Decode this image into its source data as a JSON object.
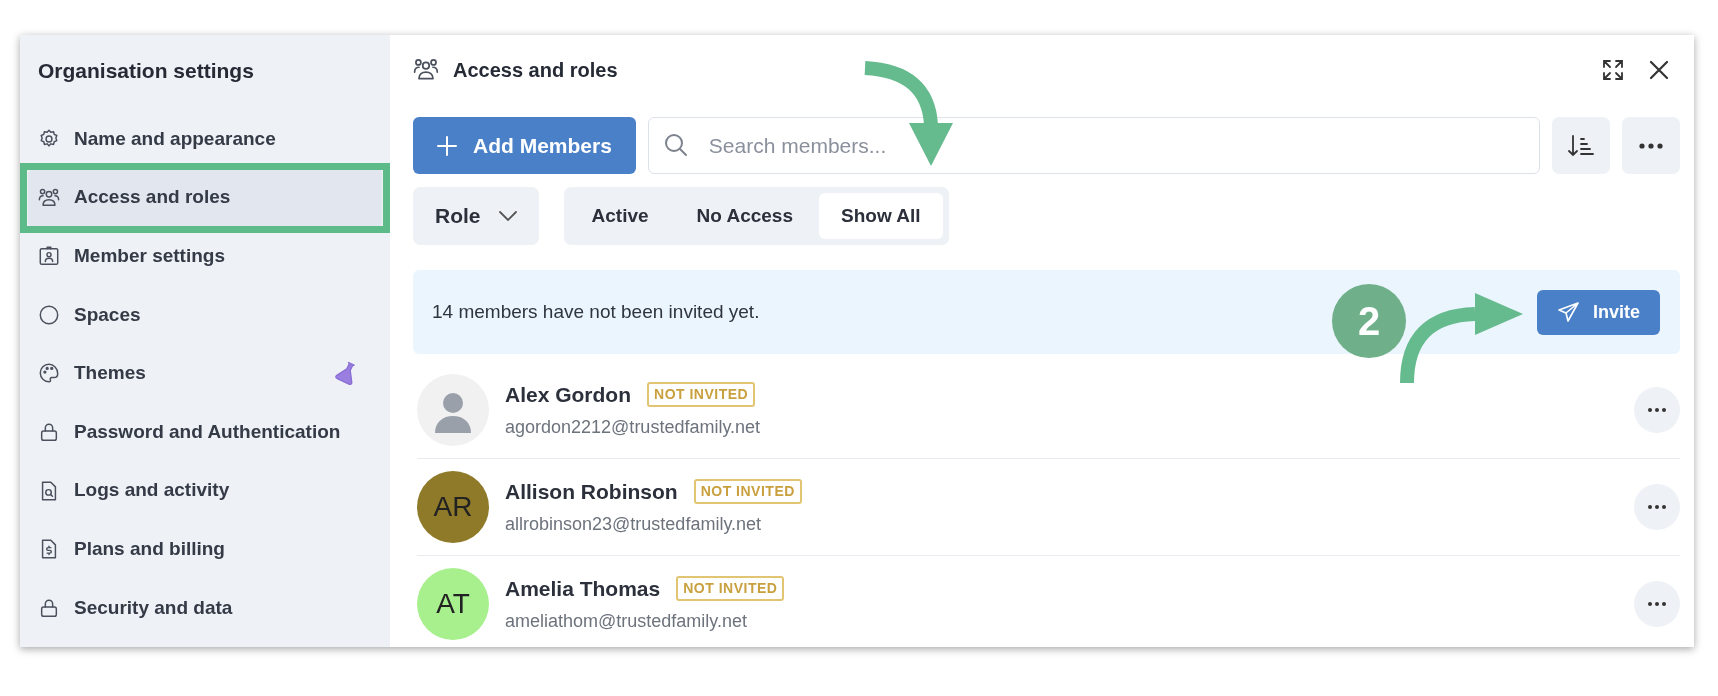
{
  "sidebar": {
    "title": "Organisation settings",
    "items": [
      {
        "label": "Name and appearance",
        "selected": false,
        "labs": false
      },
      {
        "label": "Access and roles",
        "selected": true,
        "labs": false
      },
      {
        "label": "Member settings",
        "selected": false,
        "labs": false
      },
      {
        "label": "Spaces",
        "selected": false,
        "labs": false
      },
      {
        "label": "Themes",
        "selected": false,
        "labs": true
      },
      {
        "label": "Password and Authentication",
        "selected": false,
        "labs": false
      },
      {
        "label": "Logs and activity",
        "selected": false,
        "labs": false
      },
      {
        "label": "Plans and billing",
        "selected": false,
        "labs": false
      },
      {
        "label": "Security and data",
        "selected": false,
        "labs": false
      }
    ]
  },
  "header": {
    "title": "Access and roles"
  },
  "toolbar": {
    "add_button": "Add Members",
    "search": {
      "placeholder": "Search members..."
    }
  },
  "filters": {
    "role": "Role",
    "segments": [
      {
        "label": "Active",
        "selected": false
      },
      {
        "label": "No Access",
        "selected": false
      },
      {
        "label": "Show All",
        "selected": true
      }
    ]
  },
  "banner": {
    "message": "14 members have not been invited yet.",
    "button": "Invite"
  },
  "members": [
    {
      "name": "Alex Gordon",
      "status": "NOT INVITED",
      "email": "agordon2212@trustedfamily.net",
      "avatar": {
        "kind": "photo"
      }
    },
    {
      "name": "Allison Robinson",
      "status": "NOT INVITED",
      "email": "allrobinson23@trustedfamily.net",
      "avatar": {
        "kind": "initials",
        "initials": "AR",
        "color": "#8f7a2a"
      }
    },
    {
      "name": "Amelia Thomas",
      "status": "NOT INVITED",
      "email": "ameliathom@trustedfamily.net",
      "avatar": {
        "kind": "initials",
        "initials": "AT",
        "color": "#a8f08e"
      }
    }
  ],
  "annotations": {
    "highlight_selected": true,
    "step_number": "2"
  }
}
